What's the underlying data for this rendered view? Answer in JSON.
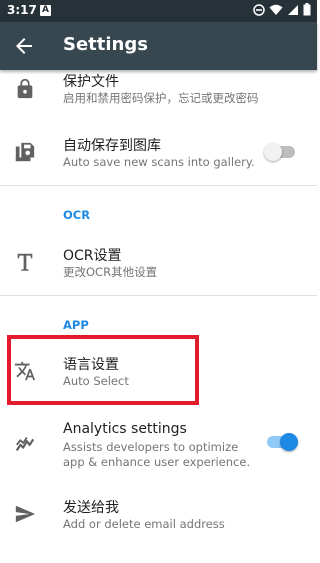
{
  "status_bar": {
    "time": "3:17",
    "notif_letter": "A"
  },
  "app_bar": {
    "title": "Settings"
  },
  "prefs": {
    "protect": {
      "title": "保护文件",
      "summary": "启用和禁用密码保护，忘记或更改密码"
    },
    "autosave": {
      "title": "自动保存到图库",
      "summary": "Auto save new scans into gallery.",
      "enabled": false
    },
    "ocr_category": "OCR",
    "ocr": {
      "title": "OCR设置",
      "summary": "更改OCR其他设置"
    },
    "app_category": "APP",
    "language": {
      "title": "语言设置",
      "summary": "Auto Select"
    },
    "analytics": {
      "title": "Analytics settings",
      "summary_line1": "Assists developers to optimize",
      "summary_line2": "app & enhance user experience.",
      "enabled": true
    },
    "send": {
      "title": "发送给我",
      "summary": "Add or delete email address"
    }
  },
  "colors": {
    "accent": "#1e88e5",
    "highlight": "#e31c2d",
    "app_bar": "#37474f",
    "status_bar": "#263238"
  },
  "icons": [
    "lock-icon",
    "save-to-gallery-icon",
    "text-T-icon",
    "translate-icon",
    "analytics-icon",
    "send-icon",
    "back-arrow-icon"
  ]
}
